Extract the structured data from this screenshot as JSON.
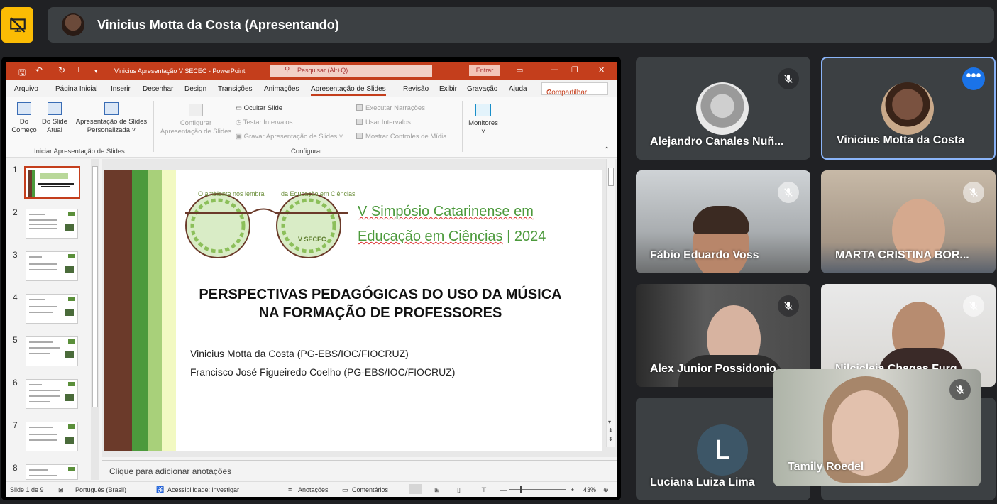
{
  "top": {
    "presenter": "Vinicius Motta da Costa (Apresentando)",
    "stop_icon": "presentation-off-icon"
  },
  "ppt": {
    "title": "Vinicius Apresentação V SECEC  -  PowerPoint",
    "search_placeholder": "Pesquisar (Alt+Q)",
    "signin": "Entrar",
    "menus": [
      "Arquivo",
      "Página Inicial",
      "Inserir",
      "Desenhar",
      "Design",
      "Transições",
      "Animações",
      "Apresentação de Slides",
      "Revisão",
      "Exibir",
      "Gravação",
      "Ajuda"
    ],
    "share": "Compartilhar",
    "ribbon": {
      "from_beginning": [
        "Do",
        "Começo"
      ],
      "from_current": [
        "Do Slide",
        "Atual"
      ],
      "custom": [
        "Apresentação de Slides",
        "Personalizada ˅"
      ],
      "group1": "Iniciar Apresentação de Slides",
      "setup": [
        "Configurar",
        "Apresentação de Slides"
      ],
      "hide_slide": "Ocultar Slide",
      "rehearse": "Testar Intervalos",
      "record": "Gravar Apresentação de Slides",
      "play_narr": "Executar Narrações",
      "use_timings": "Usar Intervalos",
      "show_controls": "Mostrar Controles de Mídia",
      "group2": "Configurar",
      "monitors": "Monitores"
    },
    "thumb_numbers": [
      "1",
      "2",
      "3",
      "4",
      "5",
      "6",
      "7",
      "8"
    ],
    "slide": {
      "event_line1": "V Simpósio Catarinense em",
      "event_line2a": "Educação em Ciências",
      "event_line2b": " | 2024",
      "fig_left": "O ambiente nos lembra",
      "fig_right": "da Educação em Ciências",
      "fig_secec": "V SECEC",
      "title_line1": "PERSPECTIVAS PEDAGÓGICAS DO USO DA MÚSICA",
      "title_line2": "NA FORMAÇÃO DE PROFESSORES",
      "author1": "Vinicius Motta da Costa (PG-EBS/IOC/FIOCRUZ)",
      "author2": "Francisco José Figueiredo Coelho (PG-EBS/IOC/FIOCRUZ)"
    },
    "notes": "Clique para adicionar anotações",
    "status": {
      "slide": "Slide 1 de 9",
      "lang": "Português (Brasil)",
      "access": "Acessibilidade: investigar",
      "notes": "Anotações",
      "comments": "Comentários",
      "zoom": "43%"
    }
  },
  "participants": [
    {
      "name": "Alejandro Canales Nuñ...",
      "muted": true
    },
    {
      "name": "Vinicius Motta da Costa",
      "muted": false
    },
    {
      "name": "Fábio Eduardo Voss",
      "muted": true
    },
    {
      "name": "MARTA CRISTINA BOR...",
      "muted": true
    },
    {
      "name": "Alex Junior Possidonio",
      "muted": true
    },
    {
      "name": "Nilcicleia Chagas Furg...",
      "muted": true
    },
    {
      "name": "Luciana Luiza Lima",
      "initial": "L"
    },
    {
      "name": "Tamily Roedel",
      "muted": true
    }
  ],
  "colors": {
    "accent": "#1a73e8",
    "ppt": "#c43e1c",
    "warning": "#fbbc04"
  }
}
